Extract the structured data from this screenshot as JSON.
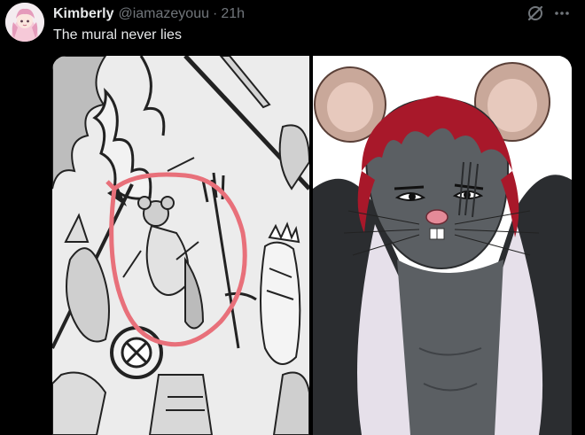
{
  "tweet": {
    "display_name": "Kimberly",
    "handle": "@iamazeyouu",
    "separator": "·",
    "time": "21h",
    "text": "The mural never lies",
    "more_icon": "more-horizontal-icon",
    "grok_icon": "grok-icon"
  },
  "colors": {
    "background": "#000000",
    "text_primary": "#e7e9ea",
    "text_secondary": "#71767b",
    "circle_highlight": "#e8707a",
    "hair_red": "#a8182a",
    "rat_skin": "#5b5f63",
    "coat": "#2b2d30"
  },
  "media": {
    "left_image": "manga-mural-panel",
    "right_image": "rat-character-illustration"
  }
}
